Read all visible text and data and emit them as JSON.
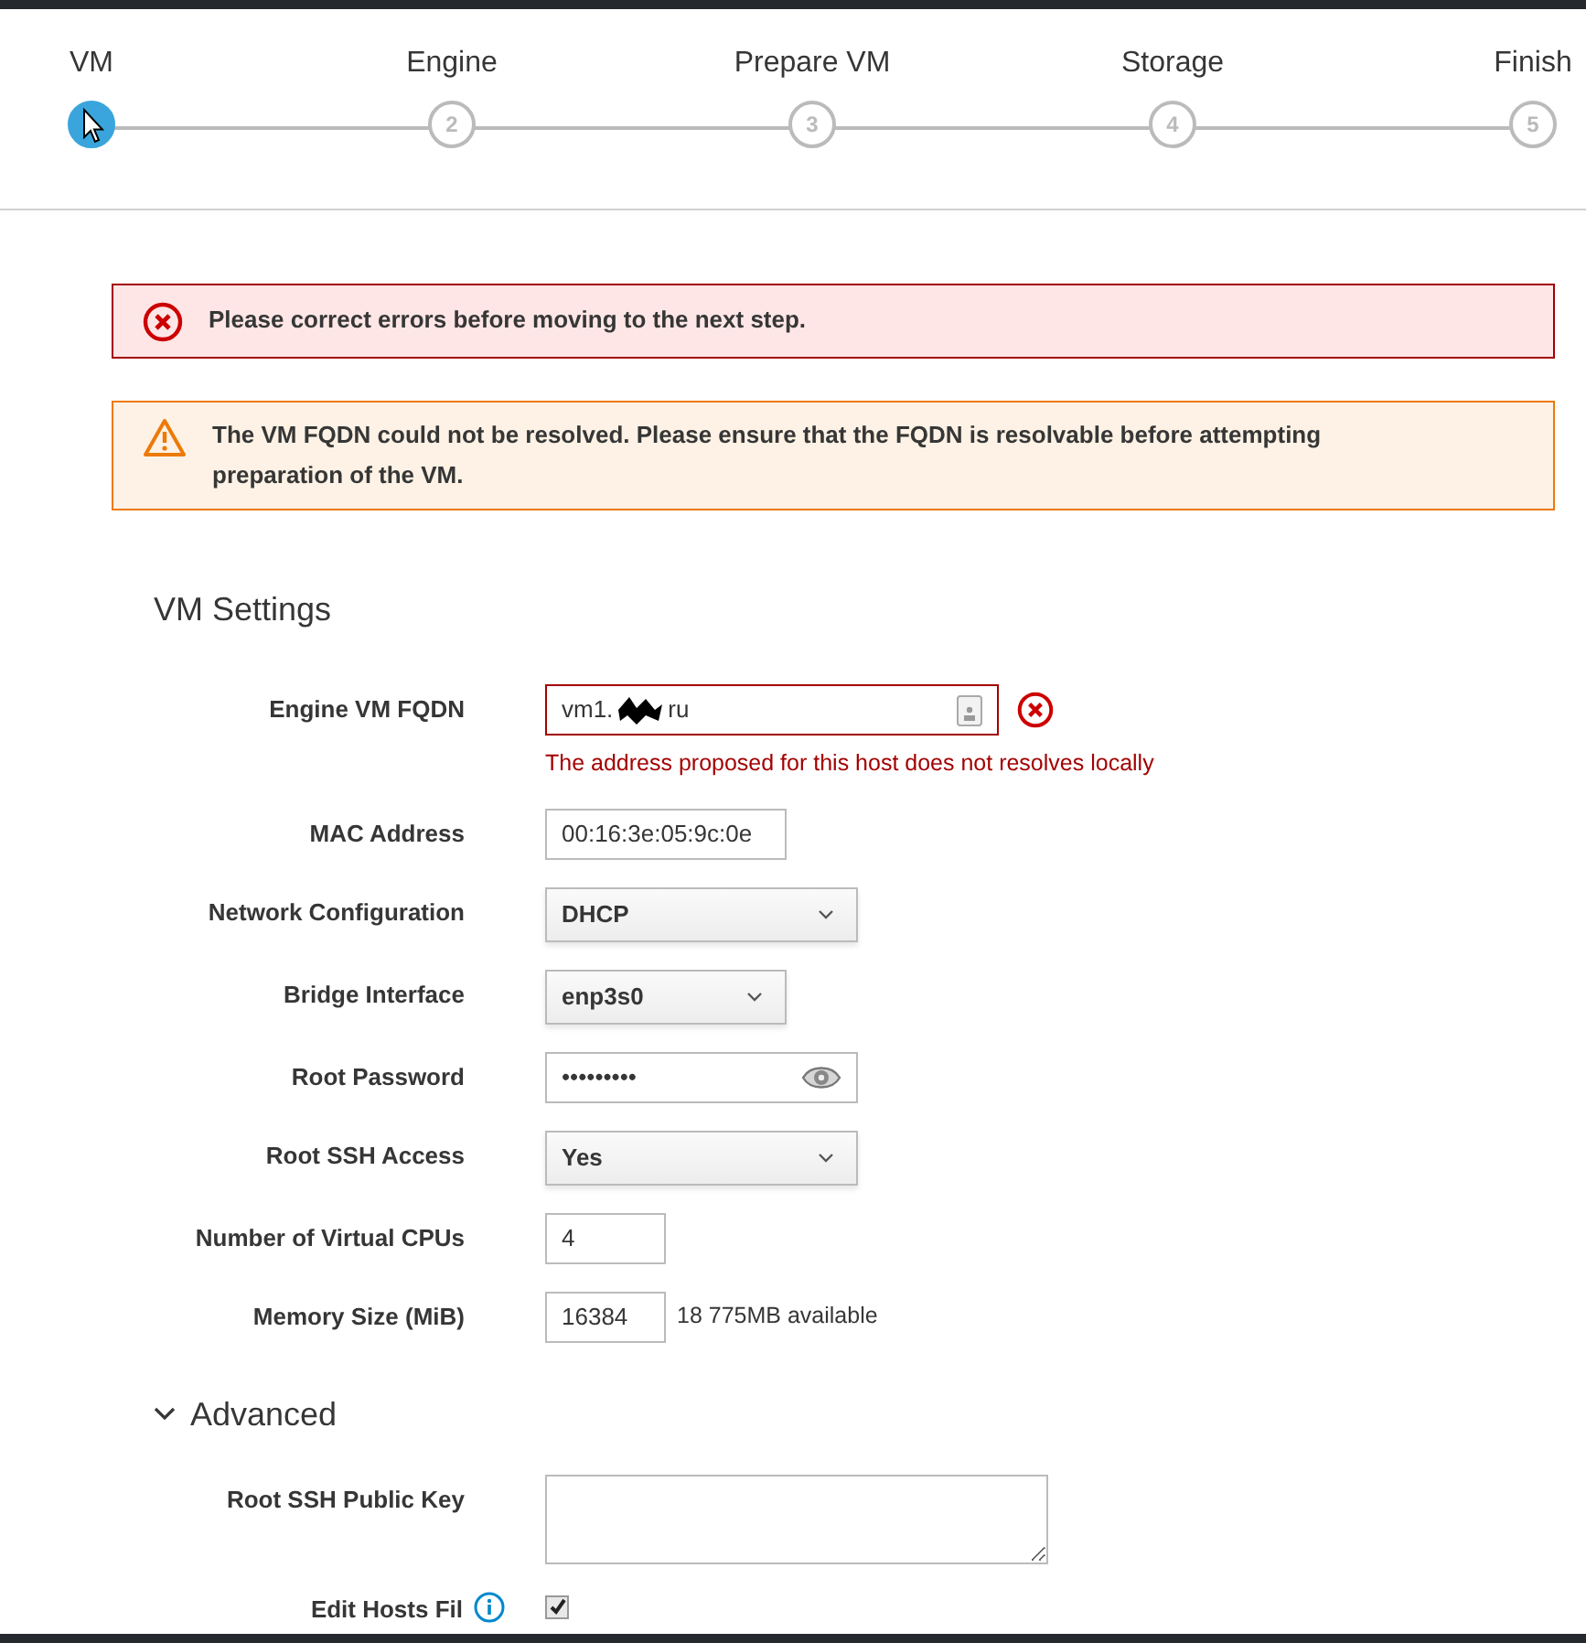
{
  "wizard_steps": [
    {
      "label": "VM",
      "selected": true
    },
    {
      "label": "Engine",
      "number": "2",
      "selected": false
    },
    {
      "label": "Prepare VM",
      "number": "3",
      "selected": false
    },
    {
      "label": "Storage",
      "number": "4",
      "selected": false
    },
    {
      "label": "Finish",
      "number": "5",
      "selected": false
    }
  ],
  "alerts": [
    {
      "kind": "error",
      "text": "Please correct errors before moving to the next step."
    },
    {
      "kind": "warning",
      "text": "The VM FQDN could not be resolved. Please ensure that the FQDN is resolvable before attempting preparation of the VM."
    }
  ],
  "section_title": "VM Settings",
  "fields": [
    {
      "kind": "text",
      "label": "Engine VM FQDN",
      "value_start": "vm1.",
      "value_end": "ru",
      "error": "The address proposed for this host does not resolves locally"
    },
    {
      "kind": "text",
      "label": "MAC Address",
      "value": "00:16:3e:05:9c:0e"
    },
    {
      "kind": "select",
      "label": "Network Configuration",
      "value": "DHCP"
    },
    {
      "kind": "select",
      "label": "Bridge Interface",
      "value": "enp3s0"
    },
    {
      "kind": "password",
      "label": "Root Password",
      "value": "•••••••••"
    },
    {
      "kind": "select",
      "label": "Root SSH Access",
      "value": "Yes"
    },
    {
      "kind": "text",
      "label": "Number of Virtual CPUs",
      "value": "4"
    },
    {
      "kind": "text",
      "label": "Memory Size (MiB)",
      "value": "16384",
      "note": "18 775MB available"
    }
  ],
  "advanced": {
    "title": "Advanced",
    "expanded": true,
    "fields": [
      {
        "kind": "textarea",
        "label": "Root SSH Public Key"
      },
      {
        "kind": "checkbox",
        "label": "Edit Hosts Fil",
        "checked": true
      }
    ]
  }
}
